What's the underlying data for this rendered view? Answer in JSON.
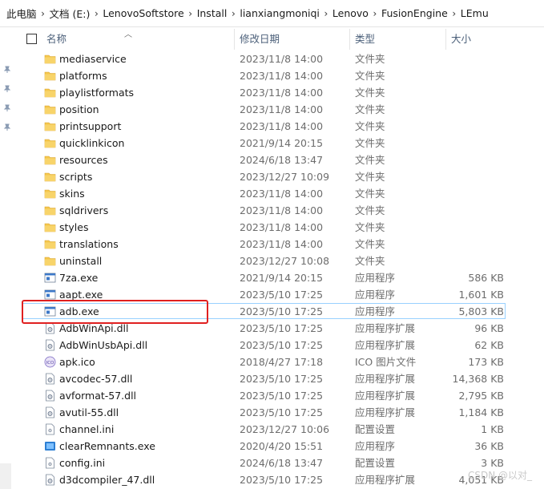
{
  "breadcrumb": [
    "此电脑",
    "文档 (E:)",
    "LenovoSoftstore",
    "Install",
    "lianxiangmoniqi",
    "Lenovo",
    "FusionEngine",
    "LEmu"
  ],
  "columns": {
    "name": "名称",
    "date": "修改日期",
    "type": "类型",
    "size": "大小"
  },
  "rows": [
    {
      "name": "mediaservice",
      "date": "2023/11/8 14:00",
      "type": "文件夹",
      "size": "",
      "icon": "folder-icon"
    },
    {
      "name": "platforms",
      "date": "2023/11/8 14:00",
      "type": "文件夹",
      "size": "",
      "icon": "folder-icon"
    },
    {
      "name": "playlistformats",
      "date": "2023/11/8 14:00",
      "type": "文件夹",
      "size": "",
      "icon": "folder-icon"
    },
    {
      "name": "position",
      "date": "2023/11/8 14:00",
      "type": "文件夹",
      "size": "",
      "icon": "folder-icon"
    },
    {
      "name": "printsupport",
      "date": "2023/11/8 14:00",
      "type": "文件夹",
      "size": "",
      "icon": "folder-icon"
    },
    {
      "name": "quicklinkicon",
      "date": "2021/9/14 20:15",
      "type": "文件夹",
      "size": "",
      "icon": "folder-icon"
    },
    {
      "name": "resources",
      "date": "2024/6/18 13:47",
      "type": "文件夹",
      "size": "",
      "icon": "folder-icon"
    },
    {
      "name": "scripts",
      "date": "2023/12/27 10:09",
      "type": "文件夹",
      "size": "",
      "icon": "folder-icon"
    },
    {
      "name": "skins",
      "date": "2023/11/8 14:00",
      "type": "文件夹",
      "size": "",
      "icon": "folder-icon"
    },
    {
      "name": "sqldrivers",
      "date": "2023/11/8 14:00",
      "type": "文件夹",
      "size": "",
      "icon": "folder-icon"
    },
    {
      "name": "styles",
      "date": "2023/11/8 14:00",
      "type": "文件夹",
      "size": "",
      "icon": "folder-icon"
    },
    {
      "name": "translations",
      "date": "2023/11/8 14:00",
      "type": "文件夹",
      "size": "",
      "icon": "folder-icon"
    },
    {
      "name": "uninstall",
      "date": "2023/12/27 10:08",
      "type": "文件夹",
      "size": "",
      "icon": "folder-icon"
    },
    {
      "name": "7za.exe",
      "date": "2021/9/14 20:15",
      "type": "应用程序",
      "size": "586 KB",
      "icon": "exe-icon"
    },
    {
      "name": "aapt.exe",
      "date": "2023/5/10 17:25",
      "type": "应用程序",
      "size": "1,601 KB",
      "icon": "exe-icon"
    },
    {
      "name": "adb.exe",
      "date": "2023/5/10 17:25",
      "type": "应用程序",
      "size": "5,803 KB",
      "icon": "exe-icon",
      "selected": true
    },
    {
      "name": "AdbWinApi.dll",
      "date": "2023/5/10 17:25",
      "type": "应用程序扩展",
      "size": "96 KB",
      "icon": "dll-icon"
    },
    {
      "name": "AdbWinUsbApi.dll",
      "date": "2023/5/10 17:25",
      "type": "应用程序扩展",
      "size": "62 KB",
      "icon": "dll-icon"
    },
    {
      "name": "apk.ico",
      "date": "2018/4/27 17:18",
      "type": "ICO 图片文件",
      "size": "173 KB",
      "icon": "ico-file-icon"
    },
    {
      "name": "avcodec-57.dll",
      "date": "2023/5/10 17:25",
      "type": "应用程序扩展",
      "size": "14,368 KB",
      "icon": "dll-icon"
    },
    {
      "name": "avformat-57.dll",
      "date": "2023/5/10 17:25",
      "type": "应用程序扩展",
      "size": "2,795 KB",
      "icon": "dll-icon"
    },
    {
      "name": "avutil-55.dll",
      "date": "2023/5/10 17:25",
      "type": "应用程序扩展",
      "size": "1,184 KB",
      "icon": "dll-icon"
    },
    {
      "name": "channel.ini",
      "date": "2023/12/27 10:06",
      "type": "配置设置",
      "size": "1 KB",
      "icon": "ini-icon"
    },
    {
      "name": "clearRemnants.exe",
      "date": "2020/4/20 15:51",
      "type": "应用程序",
      "size": "36 KB",
      "icon": "exe-color-icon"
    },
    {
      "name": "config.ini",
      "date": "2024/6/18 13:47",
      "type": "配置设置",
      "size": "3 KB",
      "icon": "ini-icon"
    },
    {
      "name": "d3dcompiler_47.dll",
      "date": "2023/5/10 17:25",
      "type": "应用程序扩展",
      "size": "4,051 KB",
      "icon": "dll-icon"
    }
  ],
  "watermark": "CSDN @以对_",
  "colors": {
    "folder": "#f5c74d",
    "selection_border": "#99d1ff",
    "annotation": "#e02020",
    "header_text": "#4c607a"
  }
}
